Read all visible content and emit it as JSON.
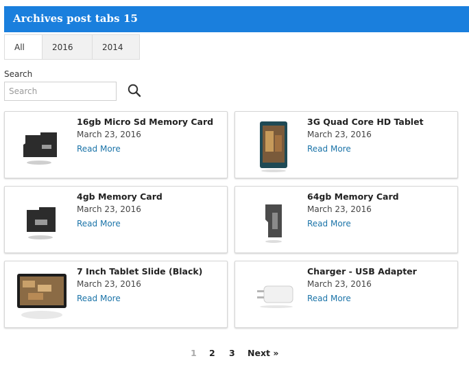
{
  "header": {
    "title": "Archives post tabs 15"
  },
  "tabs": [
    {
      "label": "All",
      "active": true
    },
    {
      "label": "2016",
      "active": false
    },
    {
      "label": "2014",
      "active": false
    }
  ],
  "search": {
    "label": "Search",
    "placeholder": "Search",
    "value": "",
    "button_icon": "search-icon"
  },
  "posts": [
    {
      "title": "16gb Micro Sd Memory Card",
      "date": "March 23, 2016",
      "link": "Read More",
      "icon": "microsd-card-icon"
    },
    {
      "title": "3G Quad Core HD Tablet",
      "date": "March 23, 2016",
      "link": "Read More",
      "icon": "tablet-icon"
    },
    {
      "title": "4gb Memory Card",
      "date": "March 23, 2016",
      "link": "Read More",
      "icon": "microsd-card-icon"
    },
    {
      "title": "64gb Memory Card",
      "date": "March 23, 2016",
      "link": "Read More",
      "icon": "sd-card-icon"
    },
    {
      "title": "7 Inch Tablet Slide (Black)",
      "date": "March 23, 2016",
      "link": "Read More",
      "icon": "tablet-landscape-icon"
    },
    {
      "title": "Charger - USB Adapter",
      "date": "March 23, 2016",
      "link": "Read More",
      "icon": "usb-charger-icon"
    }
  ],
  "pagination": {
    "current": "1",
    "pages": [
      "2",
      "3"
    ],
    "next": "Next »"
  },
  "colors": {
    "header_bg": "#1a7fdd",
    "link": "#1a73a8"
  }
}
